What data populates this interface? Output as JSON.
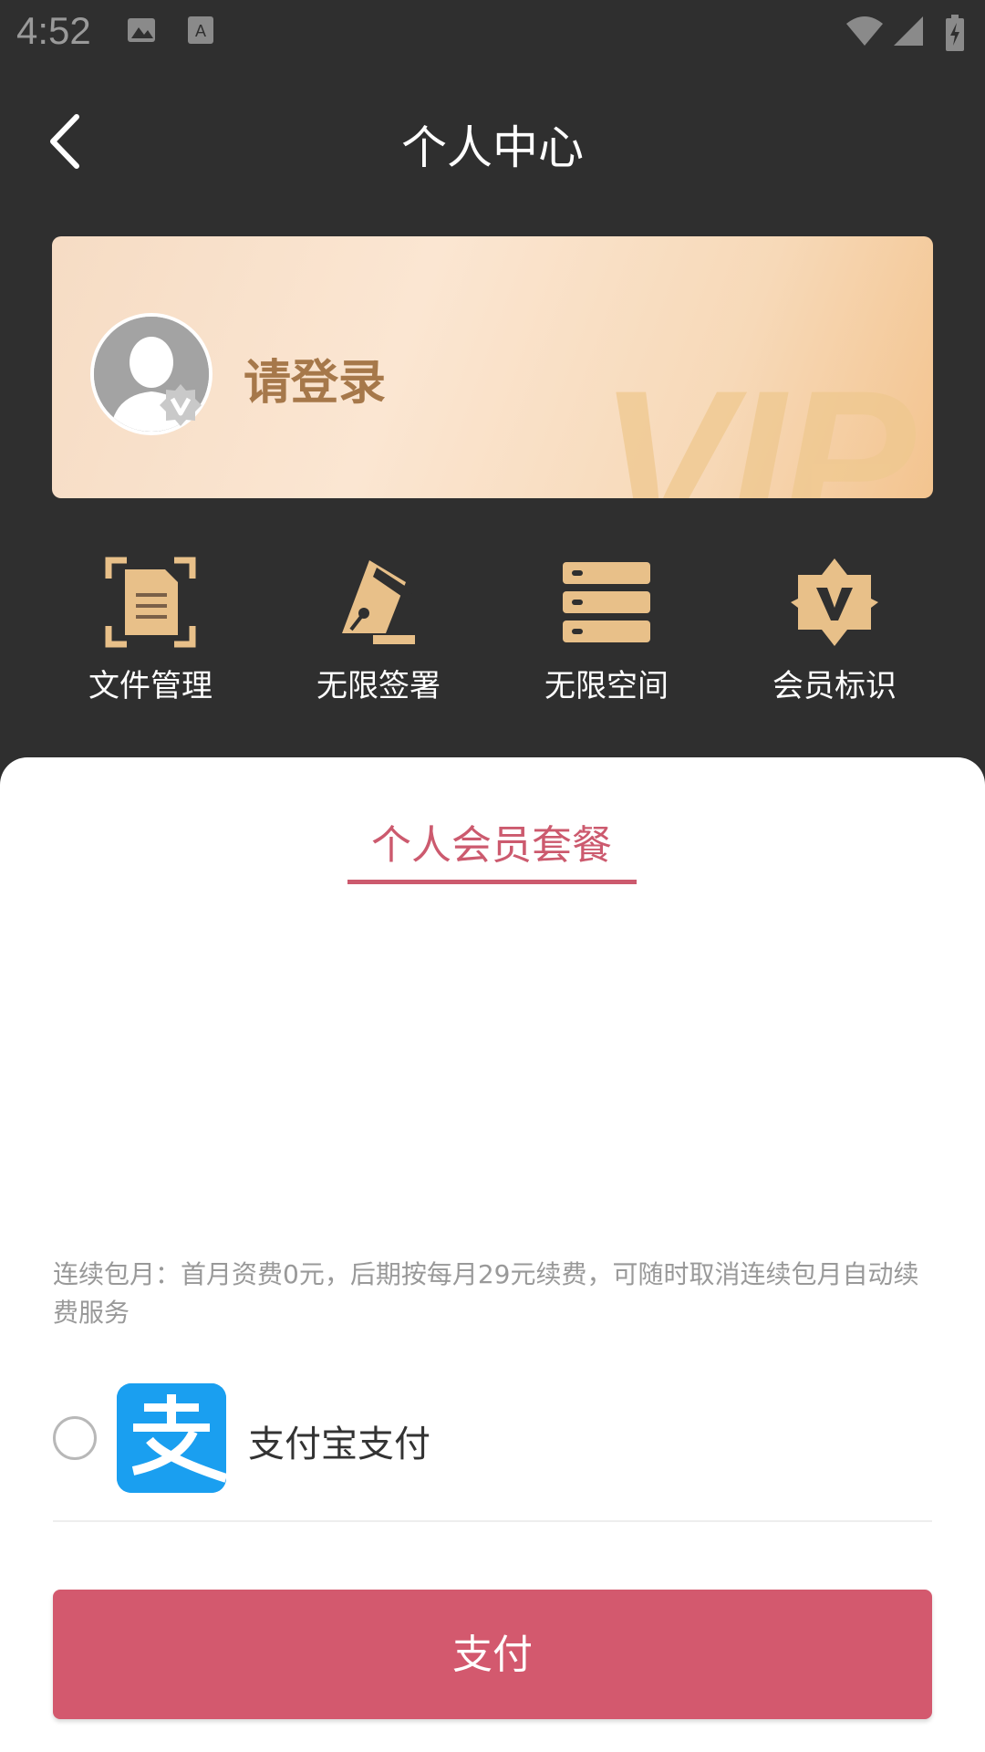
{
  "status_bar": {
    "time": "4:52"
  },
  "header": {
    "title": "个人中心"
  },
  "vip_card": {
    "login_prompt": "请登录",
    "watermark": "VIP"
  },
  "features": [
    {
      "label": "文件管理",
      "icon": "file-manage-icon"
    },
    {
      "label": "无限签署",
      "icon": "pen-nib-icon"
    },
    {
      "label": "无限空间",
      "icon": "storage-icon"
    },
    {
      "label": "会员标识",
      "icon": "vip-badge-icon"
    }
  ],
  "plan": {
    "tab_label": "个人会员套餐"
  },
  "notice": "连续包月：首月资费0元，后期按每月29元续费，可随时取消连续包月自动续费服务",
  "payment": {
    "method_label": "支付宝支付",
    "selected": false
  },
  "pay_button": {
    "label": "支付"
  },
  "colors": {
    "accent": "#d3596e",
    "gold": "#e8c089",
    "alipay": "#1a9ff0"
  }
}
